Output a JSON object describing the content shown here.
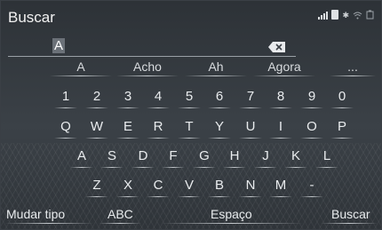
{
  "header": {
    "title": "Buscar",
    "status_icons": [
      "signal-icon",
      "phone-icon",
      "bluetooth-icon",
      "wifi-icon",
      "battery-icon"
    ]
  },
  "input": {
    "value": "A"
  },
  "predictions": [
    "A",
    "Acho",
    "Ah",
    "Agora",
    "..."
  ],
  "keyboard": {
    "row_numbers": [
      "1",
      "2",
      "3",
      "4",
      "5",
      "6",
      "7",
      "8",
      "9",
      "0"
    ],
    "row_top": [
      "Q",
      "W",
      "E",
      "R",
      "T",
      "Y",
      "U",
      "I",
      "O",
      "P"
    ],
    "row_middle": [
      "A",
      "S",
      "D",
      "F",
      "G",
      "H",
      "J",
      "K",
      "L"
    ],
    "row_bottom": [
      "Z",
      "X",
      "C",
      "V",
      "B",
      "N",
      "M",
      "-"
    ]
  },
  "bottom_bar": {
    "change_type": "Mudar tipo",
    "abc": "ABC",
    "space": "Espaço",
    "search": "Buscar"
  },
  "colors": {
    "background": "#353a40",
    "text": "#ffffff"
  }
}
